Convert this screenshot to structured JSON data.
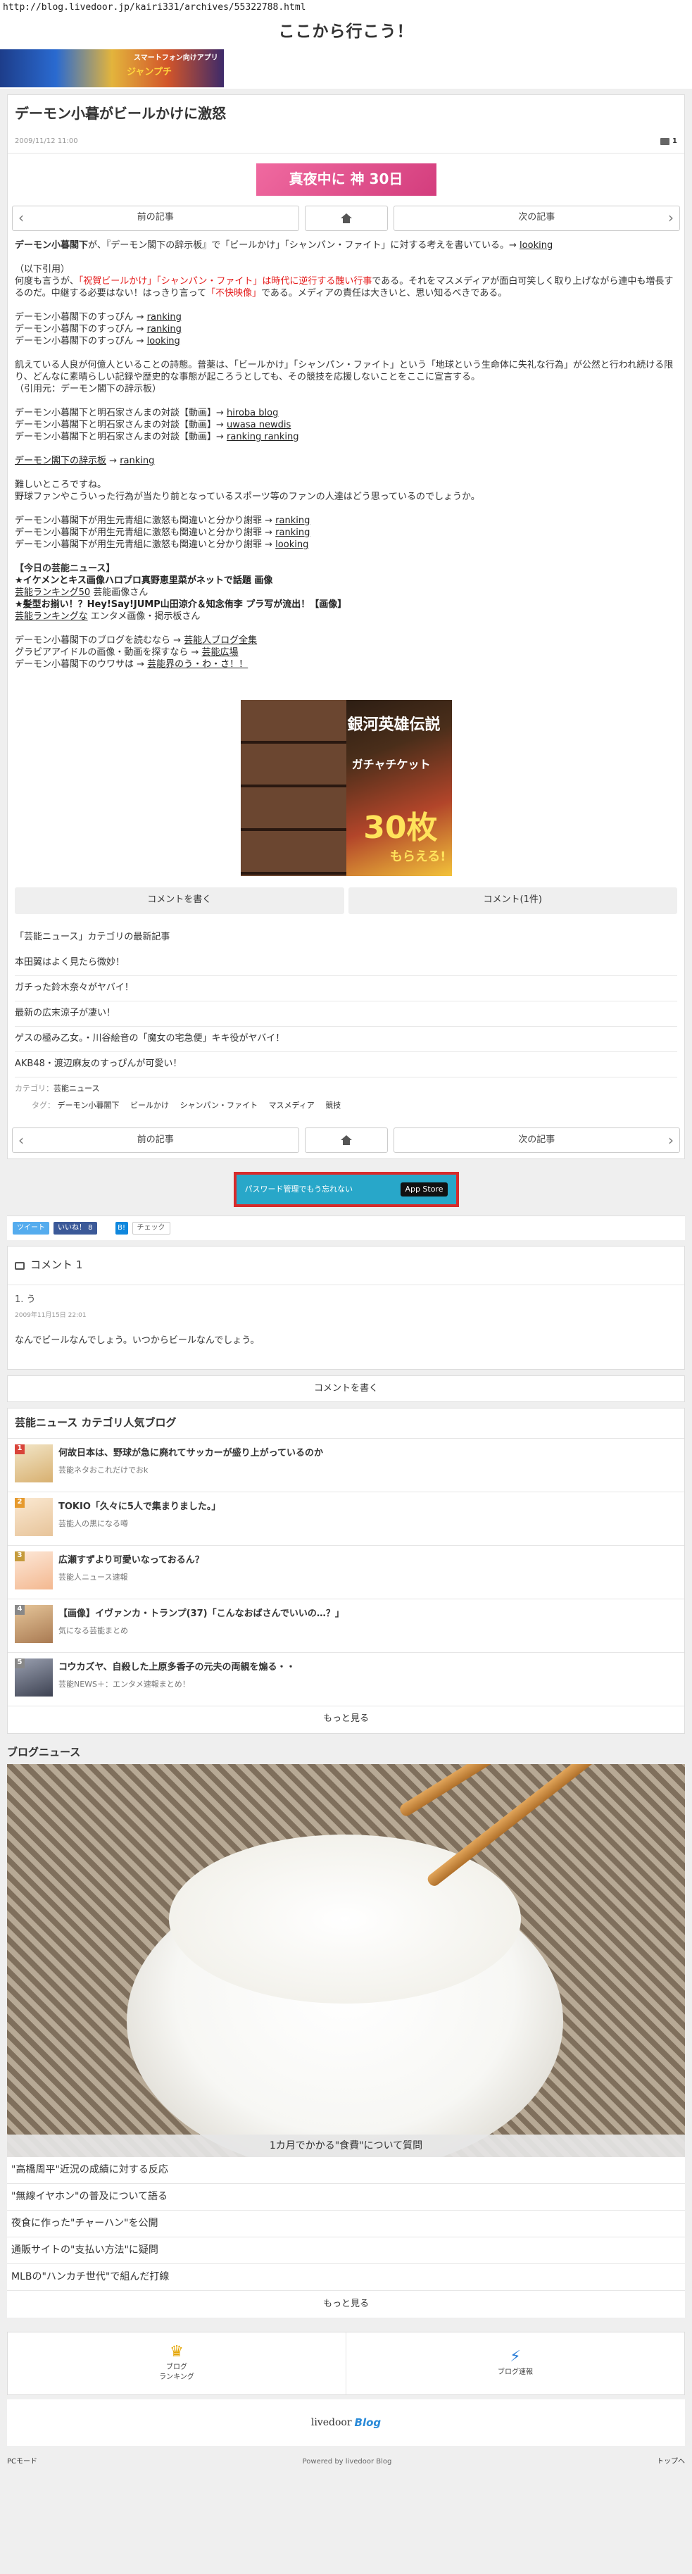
{
  "browser": {
    "url": "http://blog.livedoor.jp/kairi331/archives/55322788.html"
  },
  "site": {
    "title": "ここから行こう！",
    "banner_line1": "スマートフォン向けアプリ",
    "banner_line2": "ジャンプチ"
  },
  "article": {
    "title": "デーモン小暮がビールかけに激怒",
    "date": "2009/11/12 11:00",
    "comment_count": "1",
    "ad_top": "真夜中に 神 30日",
    "nav": {
      "prev": "前の記事",
      "next": "次の記事"
    },
    "body": {
      "lead_name": "デーモン小暮閣下",
      "lead_text": "が、『デーモン閣下の辞示板』で「ビールかけ」「シャンパン・ファイト」に対する考えを書いている。→ ",
      "lead_link": "looking",
      "quote_head": "（以下引用）",
      "q1a": "何度も言うが、",
      "q1red": "「祝賀ビールかけ」「シャンパン・ファイト」は時代に逆行する醜い行事",
      "q1b": "である。それをマスメディアが面白可笑しく取り上げながら連中も増長するのだ。中継する必要はない！はっきり言って",
      "q1red2": "「不快映像」",
      "q1c": "である。メディアの責任は大きいと、思い知るべきである。",
      "links_a": [
        {
          "text": "デーモン小暮閣下のすっぴん → ",
          "link": "ranking"
        },
        {
          "text": "デーモン小暮閣下のすっぴん → ",
          "link": "ranking"
        },
        {
          "text": "デーモン小暮閣下のすっぴん → ",
          "link": "looking"
        }
      ],
      "q2": "飢えている人良が何億人といることの詩態。普薬は、「ビールかけ」「シャンパン・ファイト」という「地球という生命体に失礼な行為」が公然と行われ続ける限り、どんなに素晴らしい記録や歴史的な事態が起ころうとしても、その競技を応援しないことをここに宣言する。",
      "q2_src": "（引用元：デーモン閣下の辞示板）",
      "links_b": [
        {
          "text": "デーモン小暮閣下と明石家さんまの対談【動画】→ ",
          "link": "hiroba blog"
        },
        {
          "text": "デーモン小暮閣下と明石家さんまの対談【動画】→ ",
          "link": "uwasa newdis"
        },
        {
          "text": "デーモン小暮閣下と明石家さんまの対談【動画】→ ",
          "link": "ranking ranking"
        }
      ],
      "board_link": "デーモン閣下の辞示板",
      "board_arrow": " → ",
      "board_link2": "ranking",
      "p3a": "難しいところですね。",
      "p3b": "野球ファンやこういった行為が当たり前となっているスポーツ等のファンの人達はどう思っているのでしょうか。",
      "links_c": [
        {
          "text": "デーモン小暮閣下が用生元青組に激怒も関違いと分かり謝罪 → ",
          "link": "ranking"
        },
        {
          "text": "デーモン小暮閣下が用生元青組に激怒も関違いと分かり謝罪 → ",
          "link": "ranking"
        },
        {
          "text": "デーモン小暮閣下が用生元青組に激怒も関違いと分かり謝罪 → ",
          "link": "looking"
        }
      ],
      "today_head": "【今日の芸能ニュース】",
      "today1": "★イケメンとキス画像ハロプロ真野恵里菜がネットで話題 画像",
      "today1_src_link": "芸能ランキング50",
      "today1_src": " 芸能画像さん",
      "today2": "★髪型お揃い！？Hey!Say!JUMP山田涼介＆知念侑李 プラ写が流出！【画像】",
      "today2_src_link": "芸能ランキングな",
      "today2_src": " エンタメ画像・掲示板さん",
      "blog1_text": "デーモン小暮閣下のブログを読むなら → ",
      "blog1_link": "芸能人ブログ全集",
      "blog2_text": "グラビアアイドルの画像・動画を探すなら → ",
      "blog2_link": "芸能広場",
      "blog3_text": "デーモン小暮閣下のウワサは → ",
      "blog3_link": "芸能界のう・わ・さ！！"
    },
    "ad_game": {
      "line1": "銀河英雄伝説",
      "line2": "ガチャチケット",
      "line3": "30枚",
      "line4": "もらえる!"
    },
    "write_comment": "コメントを書く",
    "comment_btn": "コメント(1件)"
  },
  "category": {
    "heading": "「芸能ニュース」カテゴリの最新記事",
    "items": [
      "本田翼はよく見たら微妙！",
      "ガチった鈴木奈々がヤバイ！",
      "最新の広末涼子が凄い！",
      "ゲスの極み乙女。・川谷絵音の「魔女の宅急便」キキ役がヤバイ！",
      "AKB48・渡辺麻友のすっぴんが可愛い！"
    ],
    "cat_label": "カテゴリ：",
    "cat_value": "芸能ニュース",
    "tag_label": "タグ：",
    "tags": [
      "デーモン小暮閣下",
      "ビールかけ",
      "シャンパン・ファイト",
      "マスメディア",
      "競技"
    ]
  },
  "ad_mid": {
    "text": "パスワード管理でもう忘れない",
    "store": "App Store"
  },
  "share": {
    "tweet": "ツイート",
    "like": "いいね！ 8",
    "hatena": "B!",
    "check": "チェック"
  },
  "comments": {
    "heading": "コメント 1",
    "items": [
      {
        "num": "1. う",
        "date": "2009年11月15日 22:01",
        "text": "なんでビールなんでしょう。いつからビールなんでしょう。"
      }
    ],
    "write": "コメントを書く"
  },
  "popular": {
    "heading": "芸能ニュース カテゴリ人気ブログ",
    "items": [
      {
        "rank": "1",
        "title": "何故日本は、野球が急に廃れてサッカーが盛り上がっているのか",
        "source": "芸能ネタおこれだけでおk",
        "color": "#d9443a"
      },
      {
        "rank": "2",
        "title": "TOKIO「久々に5人で集まりました。」",
        "source": "芸能人の黒になる噂",
        "color": "#e69a2e"
      },
      {
        "rank": "3",
        "title": "広瀬すずより可愛いなっておるん？",
        "source": "芸能人ニュース速報",
        "color": "#c59b3c"
      },
      {
        "rank": "4",
        "title": "【画像】イヴァンカ・トランプ(37)「こんなおばさんでいいの…？」",
        "source": "気になる芸能まとめ",
        "color": "#888888"
      },
      {
        "rank": "5",
        "title": "コウカズヤ、自殺した上原多香子の元夫の両親を煽る・・",
        "source": "芸能NEWS＋：エンタメ速報まとめ！",
        "color": "#888888"
      }
    ],
    "more": "もっと見る"
  },
  "blognews": {
    "heading": "ブログニュース",
    "caption": "1カ月でかかる\"食費\"について質問",
    "items": [
      "\"高橋周平\"近況の成績に対する反応",
      "\"無線イヤホン\"の普及について語る",
      "夜食に作った\"チャーハン\"を公開",
      "通販サイトの\"支払い方法\"に疑問",
      "MLBの\"ハンカチ世代\"で組んだ打線"
    ],
    "more": "もっと見る"
  },
  "footer": {
    "ranking1": "ブログ",
    "ranking2": "ランキング",
    "sokuho": "ブログ速報",
    "logo": "livedoor",
    "logo_blog": "Blog",
    "pc": "PCモード",
    "powered": "Powered by livedoor Blog",
    "top": "トップへ"
  }
}
